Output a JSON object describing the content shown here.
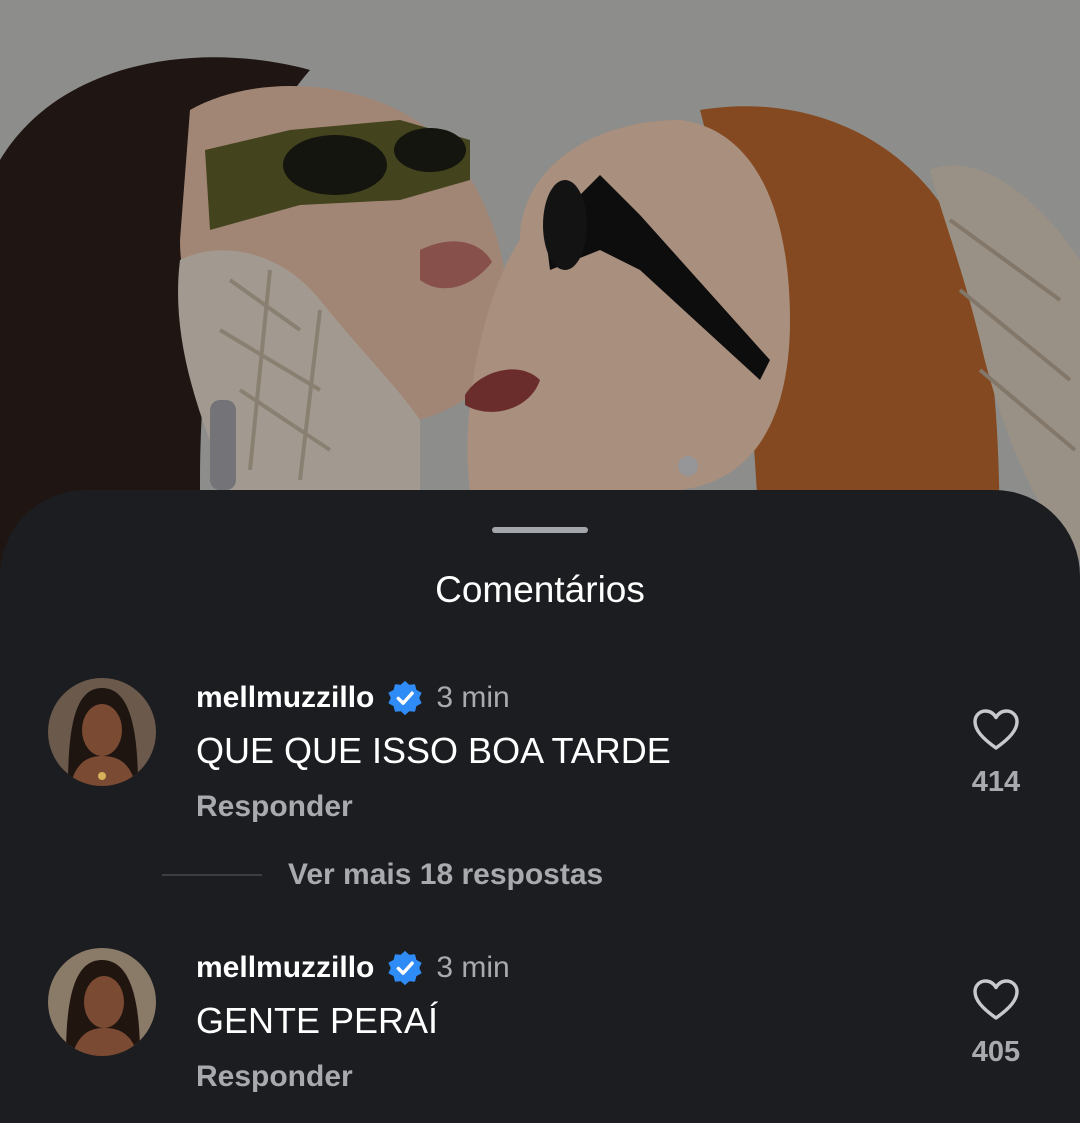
{
  "sheet": {
    "title": "Comentários"
  },
  "comments": [
    {
      "username": "mellmuzzillo",
      "time": "3 min",
      "text": "QUE QUE ISSO BOA TARDE",
      "reply_label": "Responder",
      "likes": "414"
    },
    {
      "username": "mellmuzzillo",
      "time": "3 min",
      "text": "GENTE PERAÍ",
      "reply_label": "Responder",
      "likes": "405"
    }
  ],
  "more_replies": "Ver mais 18 respostas",
  "colors": {
    "sheet_bg": "#1b1d20",
    "verified_blue": "#2f8cf6",
    "muted_text": "#a8aaae"
  }
}
